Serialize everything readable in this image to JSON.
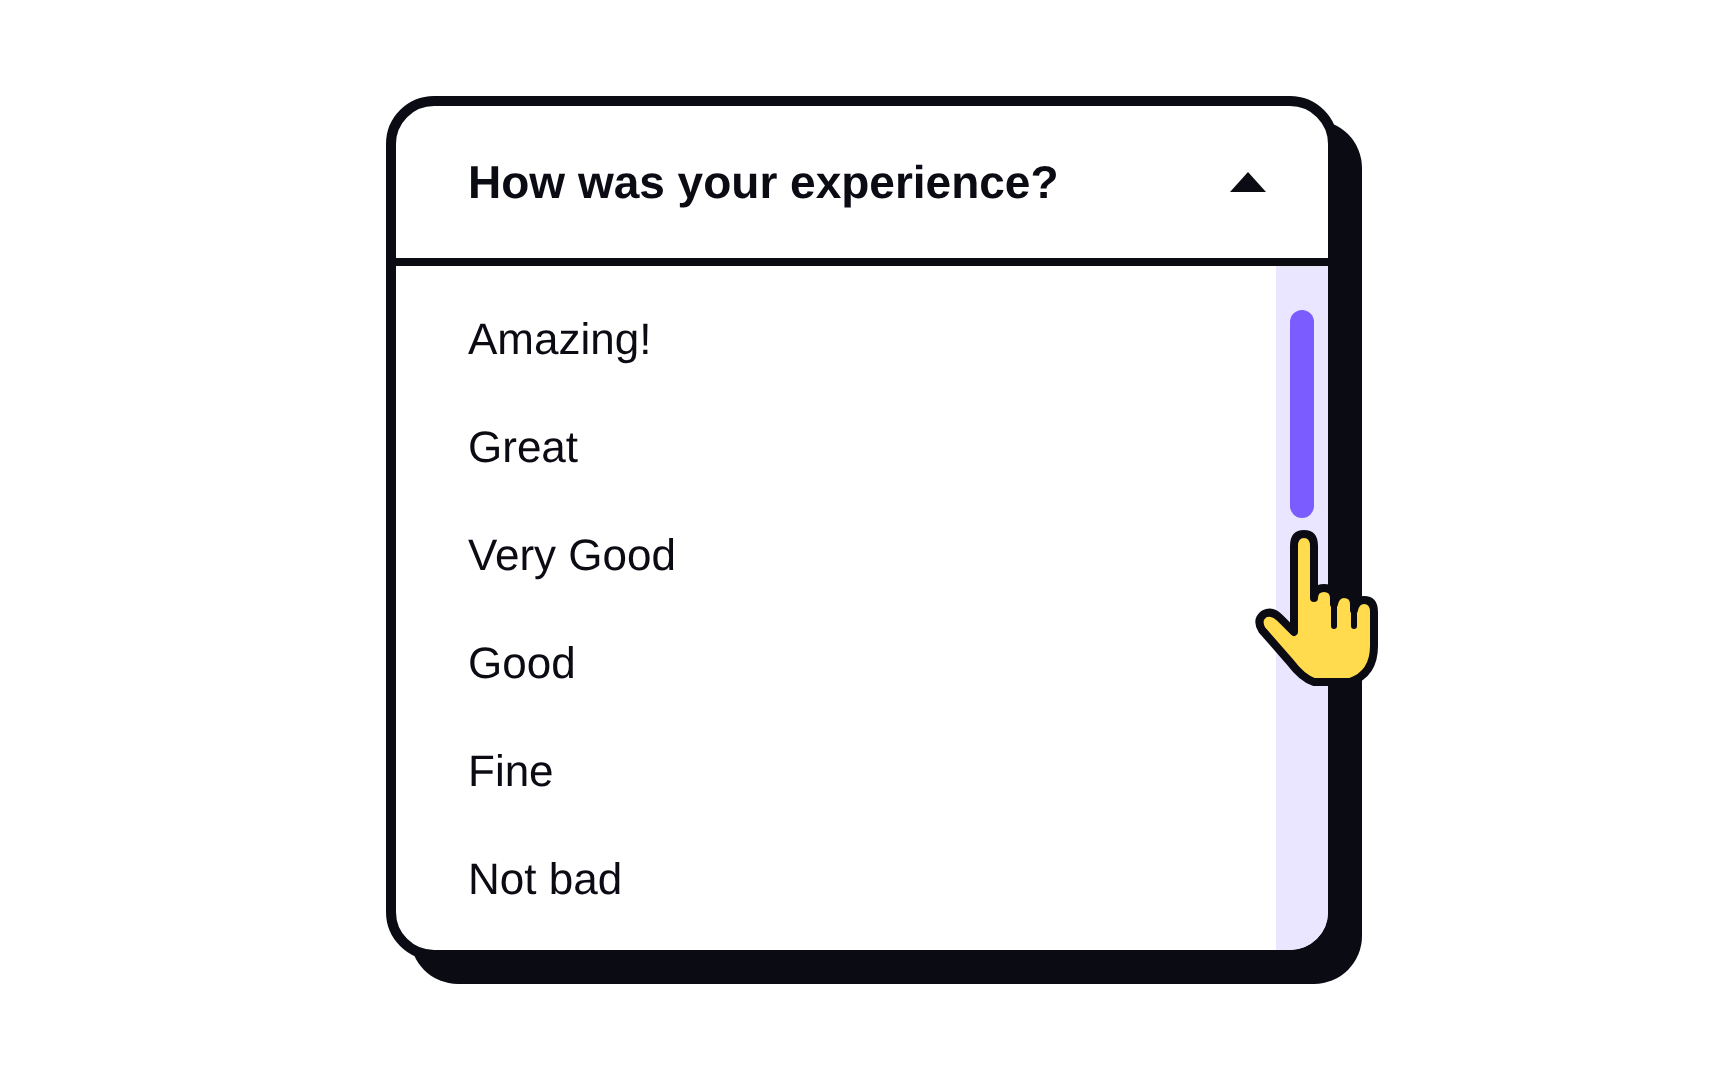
{
  "dropdown": {
    "title": "How was your experience?",
    "expanded": true,
    "options": [
      {
        "label": "Amazing!"
      },
      {
        "label": "Great"
      },
      {
        "label": "Very Good"
      },
      {
        "label": "Good"
      },
      {
        "label": "Fine"
      },
      {
        "label": "Not bad"
      }
    ]
  }
}
